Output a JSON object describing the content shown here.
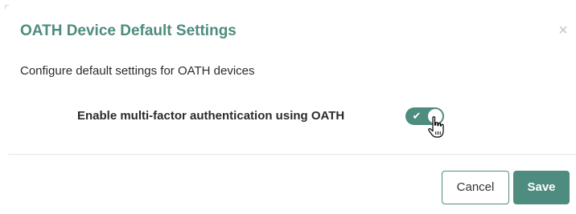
{
  "dialog": {
    "title": "OATH Device Default Settings",
    "close_glyph": "×",
    "description": "Configure default settings for OATH devices",
    "setting": {
      "label": "Enable multi-factor authentication using OATH",
      "enabled": true,
      "check_glyph": "✔"
    },
    "footer": {
      "cancel_label": "Cancel",
      "save_label": "Save"
    }
  },
  "colors": {
    "accent": "#4d8c7e",
    "text": "#2b2b2b",
    "close": "#c4c4c4",
    "divider": "#e5e5e5"
  },
  "icons": {
    "close": "close-icon",
    "check": "check-icon",
    "cursor": "hand-pointer-cursor-icon"
  }
}
